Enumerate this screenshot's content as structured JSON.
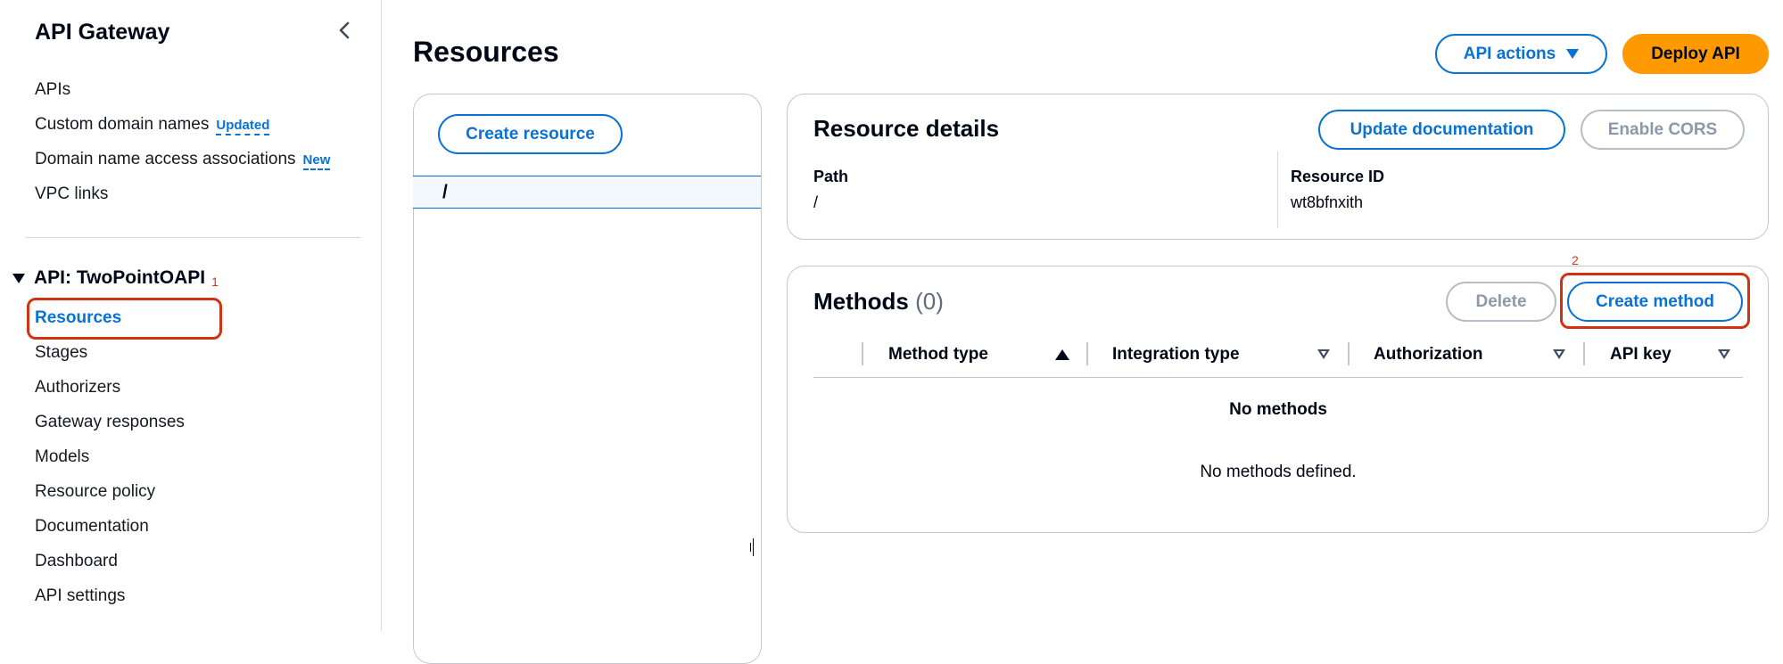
{
  "sidebar": {
    "title": "API Gateway",
    "top_items": [
      {
        "label": "APIs"
      },
      {
        "label": "Custom domain names",
        "badge": "Updated"
      },
      {
        "label": "Domain name access associations",
        "badge": "New"
      },
      {
        "label": "VPC links"
      }
    ],
    "api_section": {
      "title": "API: TwoPointOAPI",
      "annotation": "1",
      "items": [
        {
          "label": "Resources",
          "active": true
        },
        {
          "label": "Stages"
        },
        {
          "label": "Authorizers"
        },
        {
          "label": "Gateway responses"
        },
        {
          "label": "Models"
        },
        {
          "label": "Resource policy"
        },
        {
          "label": "Documentation"
        },
        {
          "label": "Dashboard"
        },
        {
          "label": "API settings"
        }
      ]
    }
  },
  "header": {
    "title": "Resources",
    "api_actions_label": "API actions",
    "deploy_label": "Deploy API"
  },
  "resource_tree": {
    "create_label": "Create resource",
    "selected_path": "/"
  },
  "resource_details": {
    "title": "Resource details",
    "update_doc_label": "Update documentation",
    "enable_cors_label": "Enable CORS",
    "path_label": "Path",
    "path_value": "/",
    "id_label": "Resource ID",
    "id_value": "wt8bfnxith"
  },
  "methods": {
    "title": "Methods",
    "count": "(0)",
    "delete_label": "Delete",
    "create_label": "Create method",
    "annotation": "2",
    "columns": [
      "Method type",
      "Integration type",
      "Authorization",
      "API key"
    ],
    "empty_title": "No methods",
    "empty_desc": "No methods defined."
  },
  "colors": {
    "accent": "#0972d3",
    "primary_button": "#ff9900",
    "annotation": "#d13212"
  }
}
